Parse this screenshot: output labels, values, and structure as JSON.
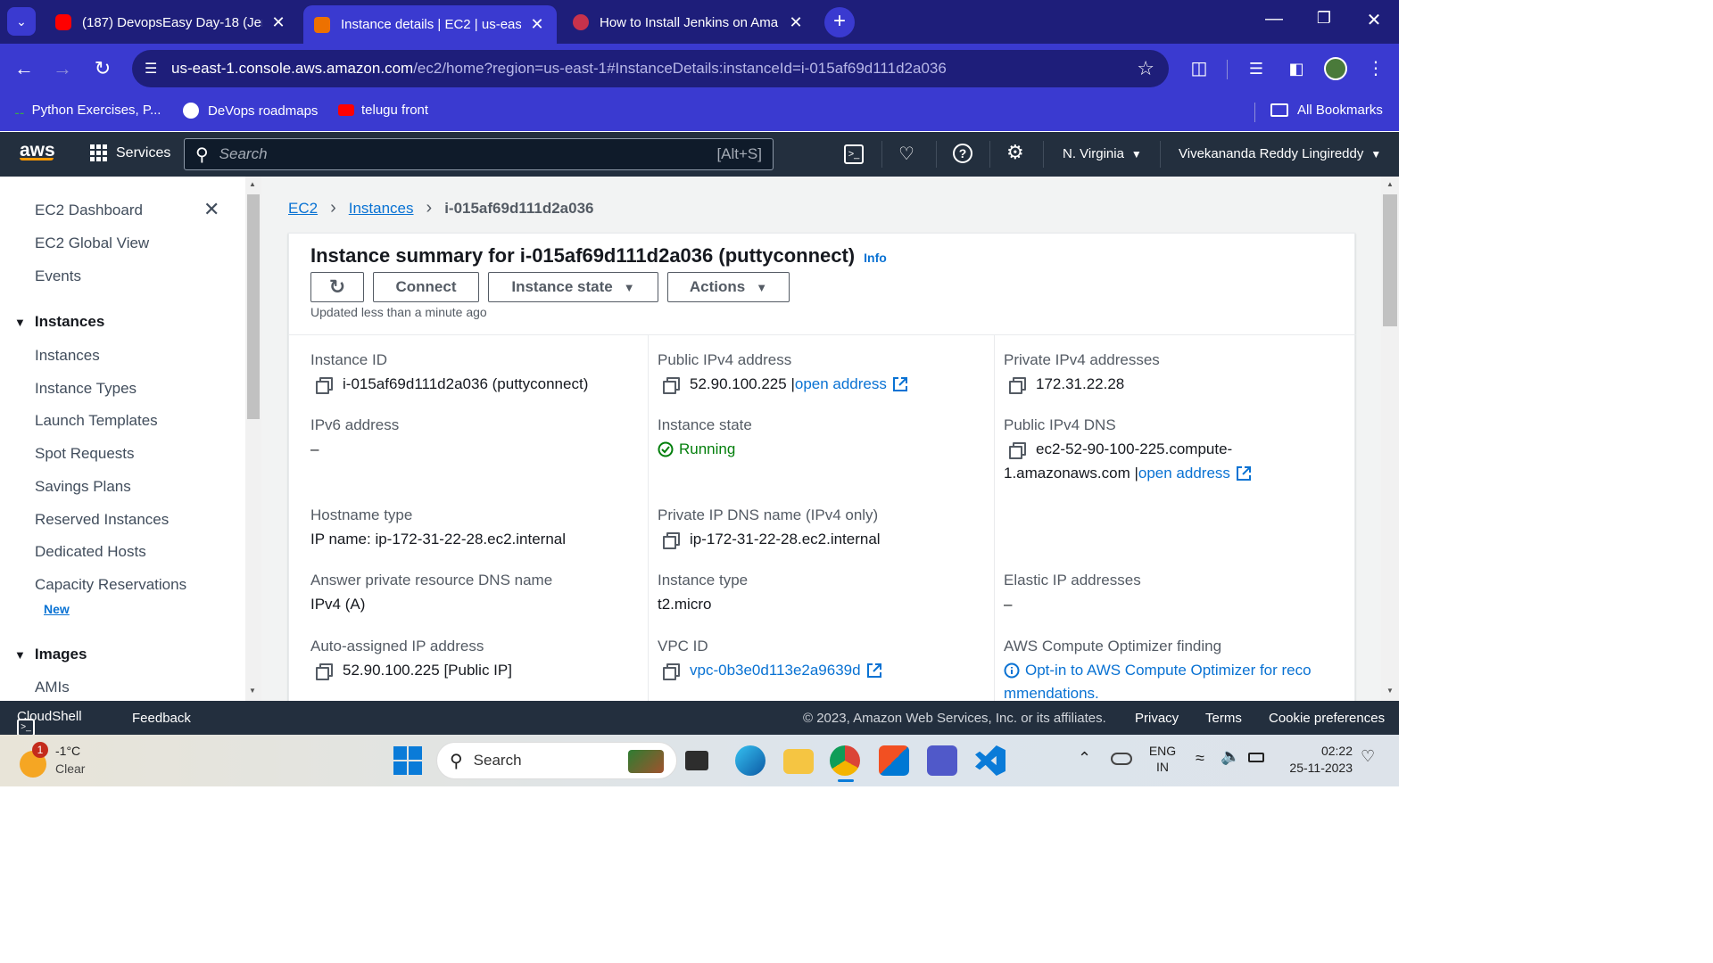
{
  "browser": {
    "tabs": [
      {
        "label": "(187) DevopsEasy Day-18 (Jenk",
        "icon": "youtube-icon"
      },
      {
        "label": "Instance details | EC2 | us-east",
        "icon": "aws-ec2-icon",
        "active": true
      },
      {
        "label": "How to Install Jenkins on Ama",
        "icon": "site-favicon-icon"
      }
    ],
    "url_host": "us-east-1.console.aws.amazon.com",
    "url_path": "/ec2/home?region=us-east-1#InstanceDetails:instanceId=i-015af69d111d2a036",
    "bookmarks": [
      "Python Exercises, P...",
      "DeVops roadmaps",
      "telugu front"
    ],
    "all_bookmarks": "All Bookmarks"
  },
  "aws_header": {
    "logo": "aws",
    "services": "Services",
    "search_placeholder": "Search",
    "search_shortcut": "[Alt+S]",
    "region": "N. Virginia",
    "user": "Vivekananda Reddy Lingireddy"
  },
  "sidenav": {
    "top_items": [
      "EC2 Dashboard",
      "EC2 Global View",
      "Events"
    ],
    "instances_header": "Instances",
    "instances_items": [
      "Instances",
      "Instance Types",
      "Launch Templates",
      "Spot Requests",
      "Savings Plans",
      "Reserved Instances",
      "Dedicated Hosts",
      "Capacity Reservations"
    ],
    "new_badge": "New",
    "images_header": "Images",
    "images_items": [
      "AMIs"
    ]
  },
  "breadcrumb": {
    "ec2": "EC2",
    "instances": "Instances",
    "current": "i-015af69d111d2a036"
  },
  "summary": {
    "title": "Instance summary for i-015af69d111d2a036 (puttyconnect)",
    "info": "Info",
    "connect": "Connect",
    "instance_state": "Instance state",
    "actions": "Actions",
    "updated": "Updated less than a minute ago"
  },
  "details": {
    "instance_id_label": "Instance ID",
    "instance_id": "i-015af69d111d2a036 (puttyconnect)",
    "public_ipv4_label": "Public IPv4 address",
    "public_ipv4": "52.90.100.225 |",
    "open_address": "open address",
    "private_ipv4_label": "Private IPv4 addresses",
    "private_ipv4": "172.31.22.28",
    "ipv6_label": "IPv6 address",
    "ipv6": "–",
    "state_label": "Instance state",
    "state": "Running",
    "public_dns_label": "Public IPv4 DNS",
    "public_dns_line1": "ec2-52-90-100-225.compute-",
    "public_dns_line2": "1.amazonaws.com |",
    "hostname_type_label": "Hostname type",
    "hostname_type": "IP name: ip-172-31-22-28.ec2.internal",
    "private_dns_label": "Private IP DNS name (IPv4 only)",
    "private_dns": "ip-172-31-22-28.ec2.internal",
    "answer_dns_label": "Answer private resource DNS name",
    "answer_dns": "IPv4 (A)",
    "instance_type_label": "Instance type",
    "instance_type": "t2.micro",
    "elastic_ip_label": "Elastic IP addresses",
    "elastic_ip": "–",
    "auto_ip_label": "Auto-assigned IP address",
    "auto_ip": "52.90.100.225 [Public IP]",
    "vpc_label": "VPC ID",
    "vpc": "vpc-0b3e0d113e2a9639d",
    "optimizer_label": "AWS Compute Optimizer finding",
    "optimizer_line1": "Opt-in to AWS Compute Optimizer for reco",
    "optimizer_line2": "mmendations."
  },
  "footer": {
    "cloudshell": "CloudShell",
    "feedback": "Feedback",
    "copyright": "© 2023, Amazon Web Services, Inc. or its affiliates.",
    "privacy": "Privacy",
    "terms": "Terms",
    "cookies": "Cookie preferences"
  },
  "taskbar": {
    "weather_temp": "-1°C",
    "weather_desc": "Clear",
    "weather_badge": "1",
    "search": "Search",
    "lang1": "ENG",
    "lang2": "IN",
    "time": "02:22",
    "date": "25-11-2023"
  },
  "colors": {
    "chrome_dark": "#1e1e7a",
    "chrome_accent": "#3a3ad0",
    "aws_nav": "#232f3e",
    "link": "#0972d3",
    "running": "#037f0c"
  }
}
